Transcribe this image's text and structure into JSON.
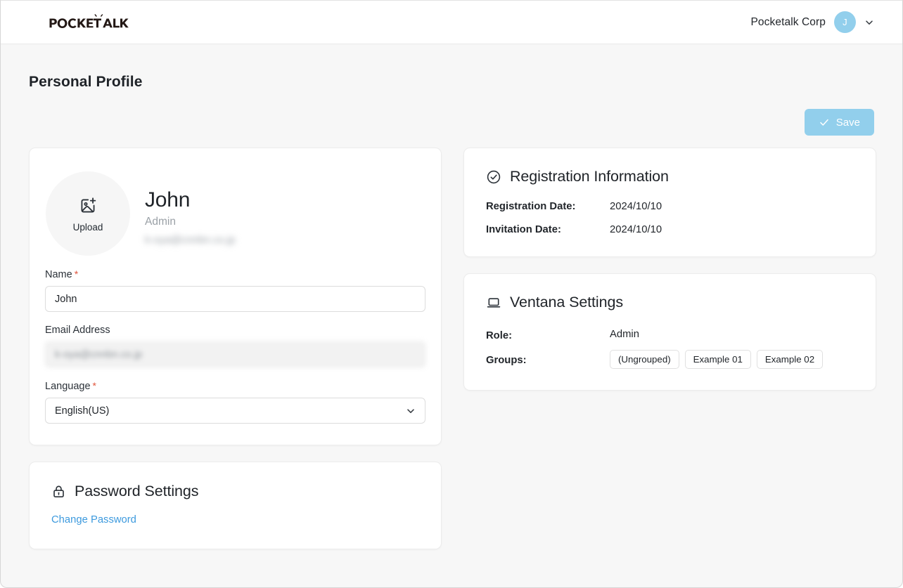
{
  "header": {
    "logo_text": "POCKETALK",
    "org_name": "Pocketalk Corp",
    "avatar_initial": "J",
    "chevron_icon": "chevron-down-icon"
  },
  "page": {
    "title": "Personal Profile"
  },
  "toolbar": {
    "save_label": "Save",
    "save_icon": "check-icon",
    "save_color": "#92cfec"
  },
  "profile": {
    "upload_label": "Upload",
    "upload_icon": "image-plus-icon",
    "name": "John",
    "role": "Admin",
    "email_masked": "k-oya@cnnbn.co.jp",
    "fields": {
      "name_label": "Name",
      "name_required": "*",
      "name_value": "John",
      "email_label": "Email Address",
      "email_value": "k-oya@cnnbn.co.jp",
      "language_label": "Language",
      "language_required": "*",
      "language_value": "English(US)",
      "language_options": [
        "English(US)"
      ],
      "language_chevron_icon": "chevron-down-icon"
    }
  },
  "password_settings": {
    "title": "Password Settings",
    "icon": "lock-icon",
    "change_password_link": "Change Password",
    "link_color": "#3d9ade"
  },
  "registration": {
    "title": "Registration Information",
    "icon": "check-circle-icon",
    "rows": [
      {
        "key": "Registration Date:",
        "value": "2024/10/10"
      },
      {
        "key": "Invitation Date:",
        "value": "2024/10/10"
      }
    ]
  },
  "ventana": {
    "title": "Ventana Settings",
    "icon": "laptop-icon",
    "role_label": "Role:",
    "role_value": "Admin",
    "groups_label": "Groups:",
    "groups": [
      "(Ungrouped)",
      "Example 01",
      "Example 02"
    ]
  }
}
